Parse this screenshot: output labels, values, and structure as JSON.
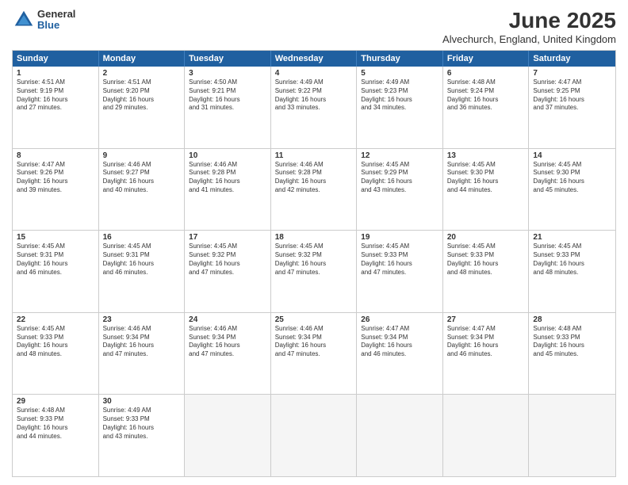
{
  "header": {
    "logo_general": "General",
    "logo_blue": "Blue",
    "month_title": "June 2025",
    "location": "Alvechurch, England, United Kingdom"
  },
  "days": [
    "Sunday",
    "Monday",
    "Tuesday",
    "Wednesday",
    "Thursday",
    "Friday",
    "Saturday"
  ],
  "weeks": [
    [
      {
        "day": "1",
        "text": "Sunrise: 4:51 AM\nSunset: 9:19 PM\nDaylight: 16 hours\nand 27 minutes."
      },
      {
        "day": "2",
        "text": "Sunrise: 4:51 AM\nSunset: 9:20 PM\nDaylight: 16 hours\nand 29 minutes."
      },
      {
        "day": "3",
        "text": "Sunrise: 4:50 AM\nSunset: 9:21 PM\nDaylight: 16 hours\nand 31 minutes."
      },
      {
        "day": "4",
        "text": "Sunrise: 4:49 AM\nSunset: 9:22 PM\nDaylight: 16 hours\nand 33 minutes."
      },
      {
        "day": "5",
        "text": "Sunrise: 4:49 AM\nSunset: 9:23 PM\nDaylight: 16 hours\nand 34 minutes."
      },
      {
        "day": "6",
        "text": "Sunrise: 4:48 AM\nSunset: 9:24 PM\nDaylight: 16 hours\nand 36 minutes."
      },
      {
        "day": "7",
        "text": "Sunrise: 4:47 AM\nSunset: 9:25 PM\nDaylight: 16 hours\nand 37 minutes."
      }
    ],
    [
      {
        "day": "8",
        "text": "Sunrise: 4:47 AM\nSunset: 9:26 PM\nDaylight: 16 hours\nand 39 minutes."
      },
      {
        "day": "9",
        "text": "Sunrise: 4:46 AM\nSunset: 9:27 PM\nDaylight: 16 hours\nand 40 minutes."
      },
      {
        "day": "10",
        "text": "Sunrise: 4:46 AM\nSunset: 9:28 PM\nDaylight: 16 hours\nand 41 minutes."
      },
      {
        "day": "11",
        "text": "Sunrise: 4:46 AM\nSunset: 9:28 PM\nDaylight: 16 hours\nand 42 minutes."
      },
      {
        "day": "12",
        "text": "Sunrise: 4:45 AM\nSunset: 9:29 PM\nDaylight: 16 hours\nand 43 minutes."
      },
      {
        "day": "13",
        "text": "Sunrise: 4:45 AM\nSunset: 9:30 PM\nDaylight: 16 hours\nand 44 minutes."
      },
      {
        "day": "14",
        "text": "Sunrise: 4:45 AM\nSunset: 9:30 PM\nDaylight: 16 hours\nand 45 minutes."
      }
    ],
    [
      {
        "day": "15",
        "text": "Sunrise: 4:45 AM\nSunset: 9:31 PM\nDaylight: 16 hours\nand 46 minutes."
      },
      {
        "day": "16",
        "text": "Sunrise: 4:45 AM\nSunset: 9:31 PM\nDaylight: 16 hours\nand 46 minutes."
      },
      {
        "day": "17",
        "text": "Sunrise: 4:45 AM\nSunset: 9:32 PM\nDaylight: 16 hours\nand 47 minutes."
      },
      {
        "day": "18",
        "text": "Sunrise: 4:45 AM\nSunset: 9:32 PM\nDaylight: 16 hours\nand 47 minutes."
      },
      {
        "day": "19",
        "text": "Sunrise: 4:45 AM\nSunset: 9:33 PM\nDaylight: 16 hours\nand 47 minutes."
      },
      {
        "day": "20",
        "text": "Sunrise: 4:45 AM\nSunset: 9:33 PM\nDaylight: 16 hours\nand 48 minutes."
      },
      {
        "day": "21",
        "text": "Sunrise: 4:45 AM\nSunset: 9:33 PM\nDaylight: 16 hours\nand 48 minutes."
      }
    ],
    [
      {
        "day": "22",
        "text": "Sunrise: 4:45 AM\nSunset: 9:33 PM\nDaylight: 16 hours\nand 48 minutes."
      },
      {
        "day": "23",
        "text": "Sunrise: 4:46 AM\nSunset: 9:34 PM\nDaylight: 16 hours\nand 47 minutes."
      },
      {
        "day": "24",
        "text": "Sunrise: 4:46 AM\nSunset: 9:34 PM\nDaylight: 16 hours\nand 47 minutes."
      },
      {
        "day": "25",
        "text": "Sunrise: 4:46 AM\nSunset: 9:34 PM\nDaylight: 16 hours\nand 47 minutes."
      },
      {
        "day": "26",
        "text": "Sunrise: 4:47 AM\nSunset: 9:34 PM\nDaylight: 16 hours\nand 46 minutes."
      },
      {
        "day": "27",
        "text": "Sunrise: 4:47 AM\nSunset: 9:34 PM\nDaylight: 16 hours\nand 46 minutes."
      },
      {
        "day": "28",
        "text": "Sunrise: 4:48 AM\nSunset: 9:33 PM\nDaylight: 16 hours\nand 45 minutes."
      }
    ],
    [
      {
        "day": "29",
        "text": "Sunrise: 4:48 AM\nSunset: 9:33 PM\nDaylight: 16 hours\nand 44 minutes."
      },
      {
        "day": "30",
        "text": "Sunrise: 4:49 AM\nSunset: 9:33 PM\nDaylight: 16 hours\nand 43 minutes."
      },
      {
        "day": "",
        "text": ""
      },
      {
        "day": "",
        "text": ""
      },
      {
        "day": "",
        "text": ""
      },
      {
        "day": "",
        "text": ""
      },
      {
        "day": "",
        "text": ""
      }
    ]
  ]
}
